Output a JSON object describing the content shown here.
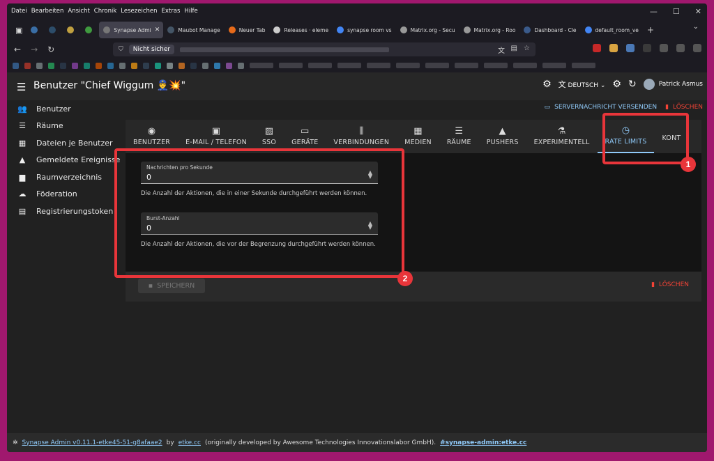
{
  "browser": {
    "menu": [
      "Datei",
      "Bearbeiten",
      "Ansicht",
      "Chronik",
      "Lesezeichen",
      "Extras",
      "Hilfe"
    ],
    "tabs": [
      {
        "label": "",
        "color": "#3a6ea5"
      },
      {
        "label": "",
        "color": "#2d4d6a"
      },
      {
        "label": "",
        "color": "#c0a040"
      },
      {
        "label": "",
        "color": "#3f9a3f"
      },
      {
        "label": "Synapse Admi",
        "color": "#777777",
        "active": true
      },
      {
        "label": "Maubot Manage",
        "color": "#445566"
      },
      {
        "label": "Neuer Tab",
        "color": "#e66a1a"
      },
      {
        "label": "Releases · eleme",
        "color": "#cccccc"
      },
      {
        "label": "synapse room vs",
        "color": "#4285f4"
      },
      {
        "label": "Matrix.org - Secu",
        "color": "#999999"
      },
      {
        "label": "Matrix.org - Roo",
        "color": "#999999"
      },
      {
        "label": "Dashboard - Cle",
        "color": "#3a5a8a"
      },
      {
        "label": "default_room_ve",
        "color": "#4285f4"
      }
    ],
    "url_badge": "Nicht sicher"
  },
  "app": {
    "title": "Benutzer \"Chief Wiggum 👮‍♂️💥\"",
    "language": "DEUTSCH",
    "user": "Patrick Asmus"
  },
  "sidebar": {
    "items": [
      {
        "label": "Benutzer",
        "icon": "people-icon"
      },
      {
        "label": "Räume",
        "icon": "list-icon"
      },
      {
        "label": "Dateien je Benutzer",
        "icon": "media-icon"
      },
      {
        "label": "Gemeldete Ereignisse",
        "icon": "warning-icon"
      },
      {
        "label": "Raumverzeichnis",
        "icon": "folder-icon"
      },
      {
        "label": "Föderation",
        "icon": "cloud-icon"
      },
      {
        "label": "Registrierungstoken",
        "icon": "ticket-icon"
      }
    ]
  },
  "actions": {
    "send_message": "SERVERNACHRICHT VERSENDEN",
    "delete": "LÖSCHEN"
  },
  "tabs": [
    {
      "label": "BENUTZER",
      "icon": "account-icon"
    },
    {
      "label": "E-MAIL / TELEFON",
      "icon": "contact-icon"
    },
    {
      "label": "SSO",
      "icon": "badge-icon"
    },
    {
      "label": "GERÄTE",
      "icon": "devices-icon"
    },
    {
      "label": "VERBINDUNGEN",
      "icon": "connections-icon"
    },
    {
      "label": "MEDIEN",
      "icon": "photo-icon"
    },
    {
      "label": "RÄUME",
      "icon": "list-icon"
    },
    {
      "label": "PUSHERS",
      "icon": "bell-icon"
    },
    {
      "label": "EXPERIMENTELL",
      "icon": "flask-icon"
    },
    {
      "label": "RATE LIMITS",
      "icon": "timer-icon",
      "active": true
    },
    {
      "label": "KONT",
      "icon": ""
    }
  ],
  "form": {
    "msg_label": "Nachrichten pro Sekunde",
    "msg_value": "0",
    "msg_help": "Die Anzahl der Aktionen, die in einer Sekunde durchgeführt werden können.",
    "burst_label": "Burst-Anzahl",
    "burst_value": "0",
    "burst_help": "Die Anzahl der Aktionen, die vor der Begrenzung durchgeführt werden können."
  },
  "buttons": {
    "save": "SPEICHERN",
    "delete": "LÖSCHEN"
  },
  "footer": {
    "version": "Synapse Admin v0.11.1-etke45-51-g8afaae2",
    "by": "by",
    "etke": "etke.cc",
    "orig": "(originally developed by Awesome Technologies Innovationslabor GmbH).",
    "room": "#synapse-admin:etke.cc"
  },
  "annotations": {
    "marker1": "1",
    "marker2": "2",
    "highlight_color": "#e8353a"
  }
}
